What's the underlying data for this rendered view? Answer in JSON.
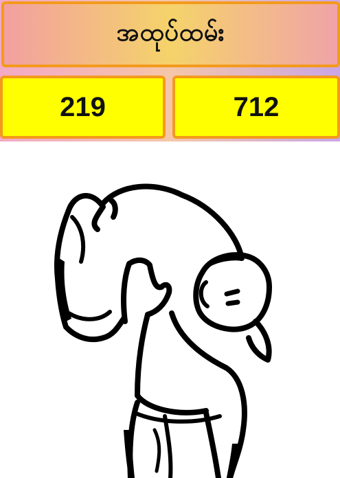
{
  "header": {
    "title": "အထုပ်ထမ်း"
  },
  "numbers": {
    "left": "219",
    "right": "712"
  },
  "colors": {
    "box_fill": "#ffff00",
    "box_border": "#f39a1c"
  },
  "illustration": {
    "icon": "porter-carrying-sack-drawing"
  }
}
